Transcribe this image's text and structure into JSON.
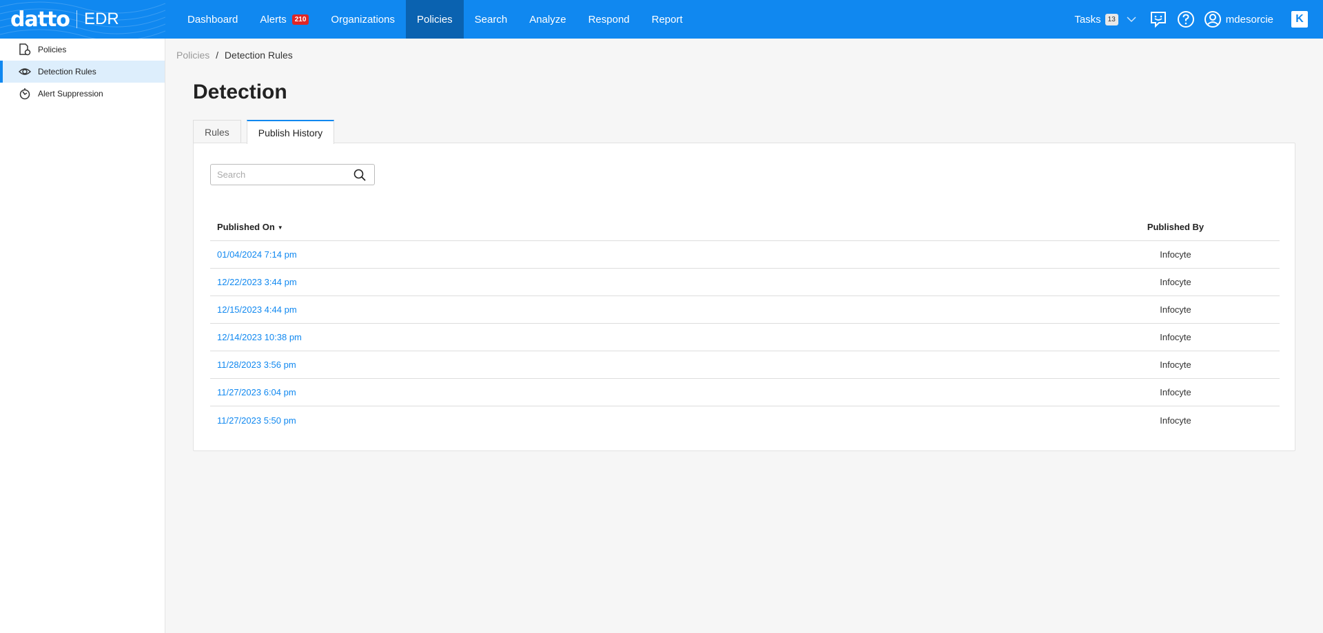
{
  "brand": {
    "name": "datto",
    "product": "EDR"
  },
  "topnav": {
    "items": [
      {
        "label": "Dashboard"
      },
      {
        "label": "Alerts",
        "badge": "210"
      },
      {
        "label": "Organizations"
      },
      {
        "label": "Policies",
        "active": true
      },
      {
        "label": "Search"
      },
      {
        "label": "Analyze"
      },
      {
        "label": "Respond"
      },
      {
        "label": "Report"
      }
    ],
    "tasks_label": "Tasks",
    "tasks_count": "13",
    "username": "mdesorcie",
    "corner_logo": "K"
  },
  "sidebar": {
    "items": [
      {
        "label": "Policies",
        "icon": "policy-icon"
      },
      {
        "label": "Detection Rules",
        "icon": "eye-icon",
        "active": true
      },
      {
        "label": "Alert Suppression",
        "icon": "suppression-icon"
      }
    ]
  },
  "breadcrumb": {
    "parent": "Policies",
    "separator": "/",
    "current": "Detection Rules"
  },
  "page": {
    "title": "Detection",
    "tabs": [
      {
        "label": "Rules"
      },
      {
        "label": "Publish History",
        "active": true
      }
    ]
  },
  "search": {
    "placeholder": "Search",
    "value": ""
  },
  "table": {
    "columns": {
      "published_on": "Published On",
      "published_by": "Published By"
    },
    "sort": "descending",
    "rows": [
      {
        "published_on": "01/04/2024 7:14 pm",
        "published_by": "Infocyte"
      },
      {
        "published_on": "12/22/2023 3:44 pm",
        "published_by": "Infocyte"
      },
      {
        "published_on": "12/15/2023 4:44 pm",
        "published_by": "Infocyte"
      },
      {
        "published_on": "12/14/2023 10:38 pm",
        "published_by": "Infocyte"
      },
      {
        "published_on": "11/28/2023 3:56 pm",
        "published_by": "Infocyte"
      },
      {
        "published_on": "11/27/2023 6:04 pm",
        "published_by": "Infocyte"
      },
      {
        "published_on": "11/27/2023 5:50 pm",
        "published_by": "Infocyte"
      }
    ]
  },
  "colors": {
    "primary": "#1088f0",
    "nav_active": "#0a62b0",
    "alert_badge": "#e02525",
    "sidebar_active": "#ddeefc"
  }
}
